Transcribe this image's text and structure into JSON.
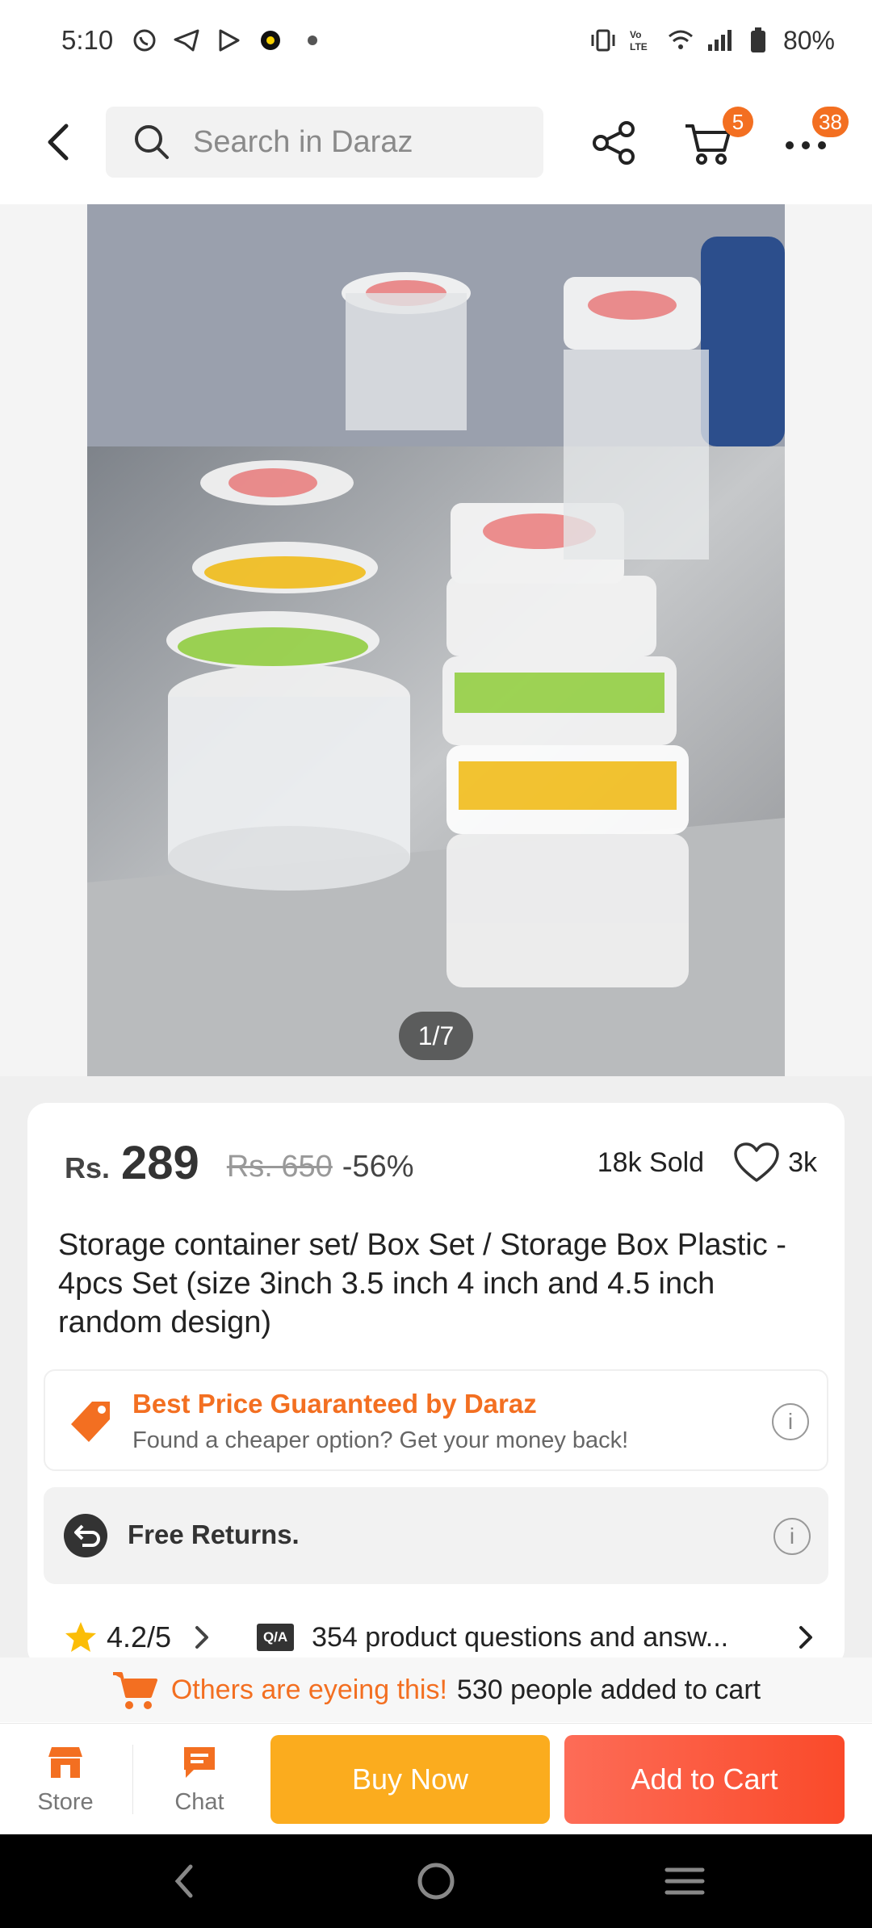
{
  "status_bar": {
    "time": "5:10",
    "battery": "80%",
    "notification_icons": [
      "whatsapp-icon",
      "telegram-icon",
      "play-icon",
      "app-icon",
      "dot-icon"
    ],
    "system_icons": [
      "vibrate-icon",
      "volte-icon",
      "wifi-icon",
      "signal-icon",
      "battery-icon"
    ]
  },
  "header": {
    "search_placeholder": "Search in Daraz",
    "cart_badge": "5",
    "more_badge": "38"
  },
  "gallery": {
    "pager": "1/7"
  },
  "product": {
    "currency": "Rs.",
    "price": "289",
    "old_price": "Rs. 650",
    "discount": "-56%",
    "sold": "18k Sold",
    "wishlist_count": "3k",
    "title": "Storage  container  set/ Box Set /  Storage Box Plastic - 4pcs Set (size 3inch 3.5 inch 4 inch and 4.5 inch random design)"
  },
  "guarantee": {
    "title": "Best Price Guaranteed by Daraz",
    "subtitle": "Found a cheaper option? Get your money back!",
    "info": "i"
  },
  "returns": {
    "label": "Free Returns.",
    "info": "i"
  },
  "rating": {
    "score": "4.2/5",
    "qa_badge": "Q/A",
    "qa_text": "354 product questions and answ..."
  },
  "eyeing": {
    "highlight": "Others are eyeing this!",
    "rest": "530 people added to cart"
  },
  "action_bar": {
    "store_label": "Store",
    "chat_label": "Chat",
    "buy_now": "Buy Now",
    "add_to_cart": "Add to Cart"
  },
  "colors": {
    "brand_orange": "#f36f21",
    "buy_now": "#fbac1e",
    "add_to_cart": "#fa4a2a"
  }
}
